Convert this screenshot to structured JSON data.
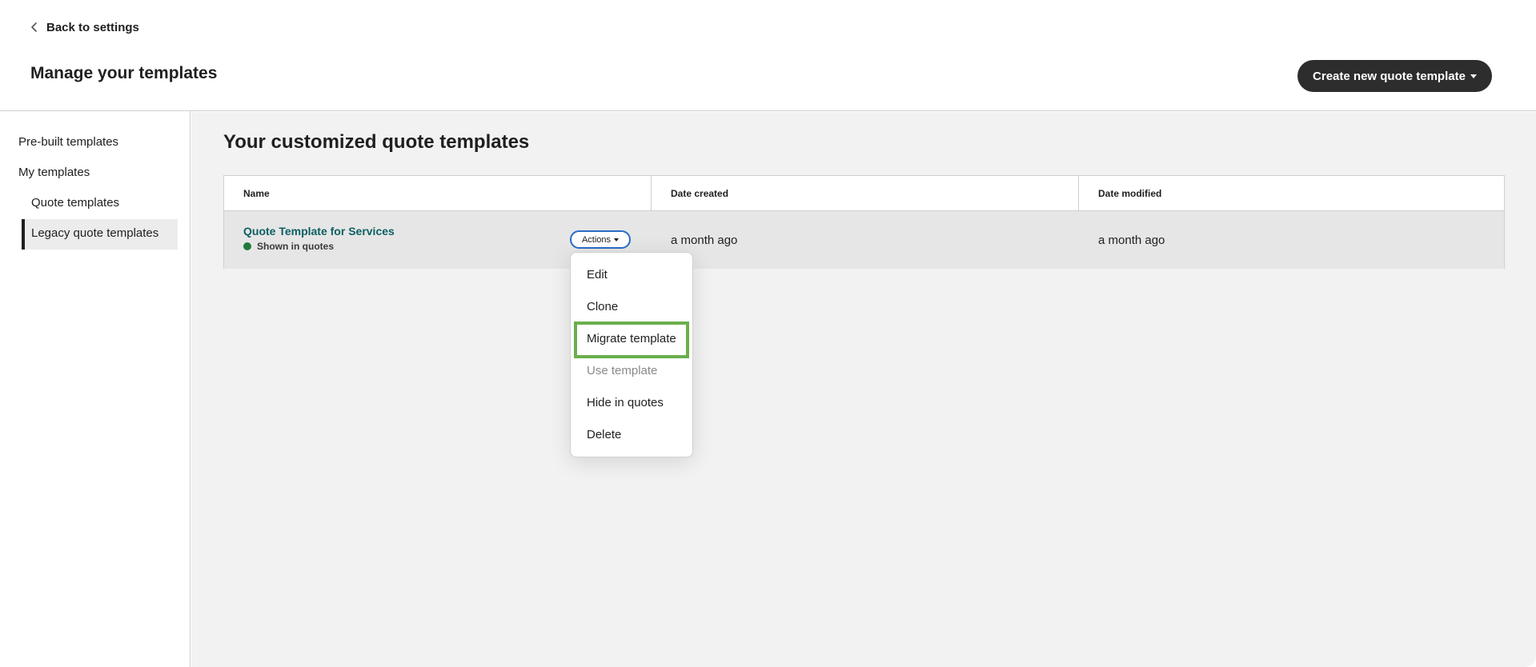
{
  "header": {
    "back_label": "Back to settings",
    "title": "Manage your templates",
    "create_button_label": "Create new quote template"
  },
  "sidebar": {
    "items": [
      {
        "label": "Pre-built templates"
      },
      {
        "label": "My templates"
      },
      {
        "label": "Quote templates"
      },
      {
        "label": "Legacy quote templates",
        "active": true
      }
    ]
  },
  "main": {
    "section_title": "Your customized quote templates",
    "table": {
      "columns": [
        "Name",
        "Date created",
        "Date modified"
      ],
      "rows": [
        {
          "name": "Quote Template for Services",
          "status": "Shown in quotes",
          "actions_label": "Actions",
          "date_created": "a month ago",
          "date_modified": "a month ago"
        }
      ]
    }
  },
  "actions_menu": {
    "items": [
      {
        "label": "Edit",
        "disabled": false
      },
      {
        "label": "Clone",
        "disabled": false
      },
      {
        "label": "Migrate template",
        "disabled": false,
        "highlighted": true
      },
      {
        "label": "Use template",
        "disabled": true
      },
      {
        "label": "Hide in quotes",
        "disabled": false
      },
      {
        "label": "Delete",
        "disabled": false
      }
    ]
  },
  "colors": {
    "link": "#0d5f63",
    "status_dot": "#1f7a3a",
    "highlight": "#6aaf4c",
    "actions_border": "#2a6cc7",
    "primary_button": "#2d2d2d"
  }
}
